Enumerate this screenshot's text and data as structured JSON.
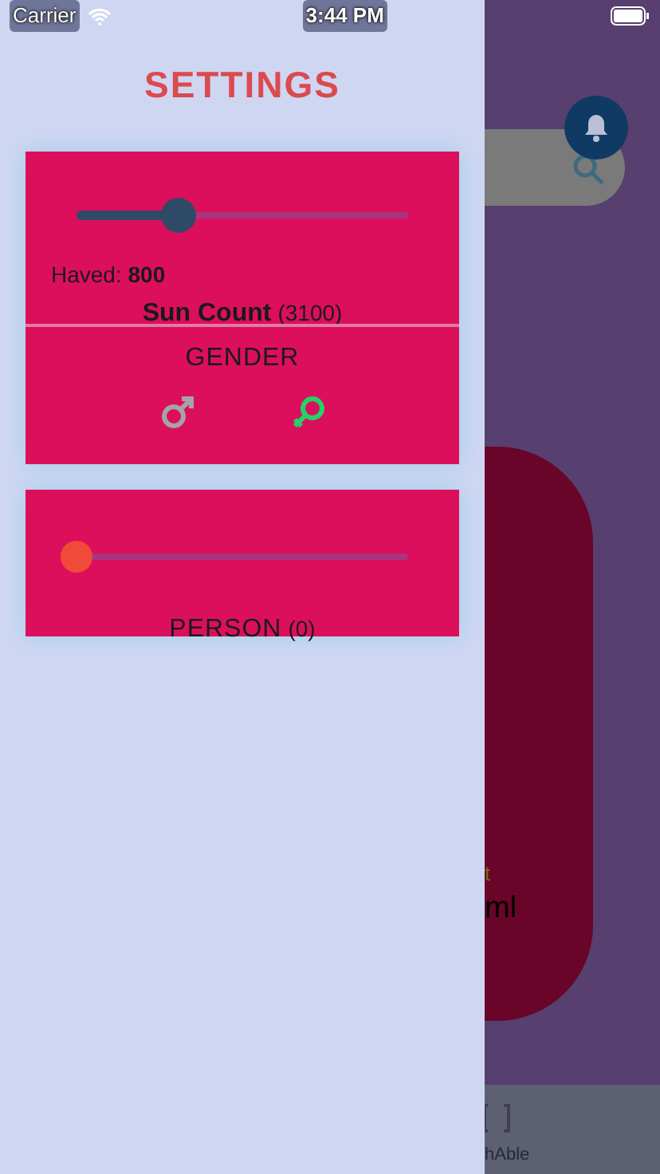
{
  "status_bar": {
    "carrier": "Carrier",
    "time": "3:44 PM"
  },
  "drawer": {
    "title": "SETTINGS",
    "sun_card": {
      "slider": {
        "level": 0.31
      },
      "haved": "Haved: **800**",
      "label": "Sun Count",
      "count": "(3100)"
    },
    "gender": {
      "title": "GENDER",
      "options": [
        {
          "kind": "male",
          "selected": false
        },
        {
          "kind": "female",
          "selected": true
        }
      ]
    },
    "person_card": {
      "slider": {
        "level": 0
      },
      "label": "PERSON",
      "count": "(0)"
    }
  },
  "background": {
    "texts": [
      "t",
      "ml",
      "hAble"
    ]
  }
}
